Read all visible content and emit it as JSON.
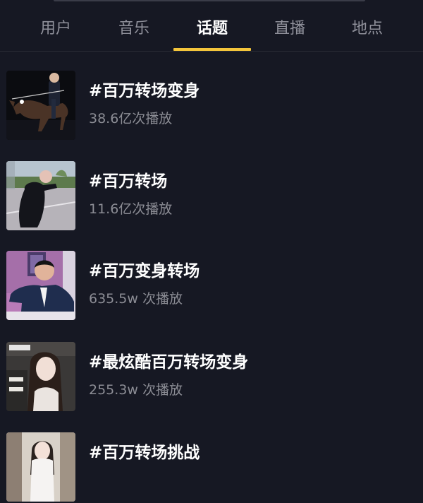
{
  "tabs": [
    {
      "label": "用户",
      "active": false
    },
    {
      "label": "音乐",
      "active": false
    },
    {
      "label": "话题",
      "active": true
    },
    {
      "label": "直播",
      "active": false
    },
    {
      "label": "地点",
      "active": false
    }
  ],
  "colors": {
    "background": "#161823",
    "accent": "#f4c53b",
    "muted_text": "#8c8d95"
  },
  "topics": [
    {
      "title": "#百万转场变身",
      "plays": "38.6亿次播放",
      "thumb_icon": "rider-on-horse-thumbnail"
    },
    {
      "title": "#百万转场",
      "plays": "11.6亿次播放",
      "thumb_icon": "outdoor-dance-thumbnail"
    },
    {
      "title": "#百万变身转场",
      "plays": "635.5w 次播放",
      "thumb_icon": "man-in-suit-thumbnail"
    },
    {
      "title": "#最炫酷百万转场变身",
      "plays": "255.3w 次播放",
      "thumb_icon": "woman-portrait-thumbnail"
    },
    {
      "title": "#百万转场挑战",
      "plays": "",
      "thumb_icon": "girl-indoor-thumbnail"
    }
  ]
}
